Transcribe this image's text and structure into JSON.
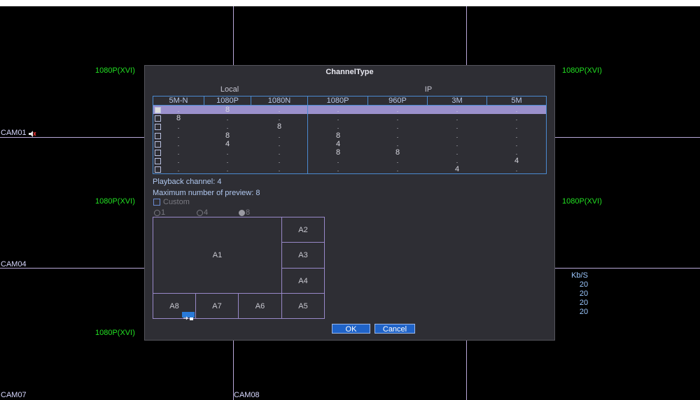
{
  "cameras": {
    "res_labels": [
      "1080P(XVI)",
      "1080P(XVI)",
      "1080P(XVI)",
      "1080P(XVI)",
      "1080P(XVI)"
    ],
    "cam_labels": [
      "CAM01",
      "CAM04",
      "CAM07",
      "CAM08"
    ],
    "kbps": {
      "header": "Kb/S",
      "values": [
        "20",
        "20",
        "20",
        "20"
      ]
    }
  },
  "dialog": {
    "title": "ChannelType",
    "groups": {
      "local": "Local",
      "ip": "IP"
    },
    "columns": [
      "5M-N",
      "1080P",
      "1080N",
      "1080P",
      "960P",
      "3M",
      "5M"
    ],
    "rows": [
      {
        "checked": true,
        "cells": [
          ".",
          "8",
          ".",
          ".",
          ".",
          ".",
          "."
        ]
      },
      {
        "checked": false,
        "cells": [
          "8",
          ".",
          ".",
          ".",
          ".",
          ".",
          "."
        ]
      },
      {
        "checked": false,
        "cells": [
          ".",
          ".",
          "8",
          ".",
          ".",
          ".",
          "."
        ]
      },
      {
        "checked": false,
        "cells": [
          ".",
          "8",
          ".",
          "8",
          ".",
          ".",
          "."
        ]
      },
      {
        "checked": false,
        "cells": [
          ".",
          "4",
          ".",
          "4",
          ".",
          ".",
          "."
        ]
      },
      {
        "checked": false,
        "cells": [
          ".",
          ".",
          ".",
          "8",
          "8",
          ".",
          "."
        ]
      },
      {
        "checked": false,
        "cells": [
          ".",
          ".",
          ".",
          ".",
          ".",
          ".",
          "4"
        ]
      },
      {
        "checked": false,
        "cells": [
          ".",
          ".",
          ".",
          ".",
          ".",
          "4",
          "."
        ]
      }
    ],
    "playback": "Playback channel: 4",
    "max_preview": "Maximum number of preview: 8",
    "custom_label": "Custom",
    "layout_options": [
      "1",
      "4",
      "8"
    ],
    "layout_selected": "8",
    "areas": [
      "A1",
      "A2",
      "A3",
      "A4",
      "A5",
      "A6",
      "A7",
      "A8"
    ],
    "ok": "OK",
    "cancel": "Cancel"
  }
}
